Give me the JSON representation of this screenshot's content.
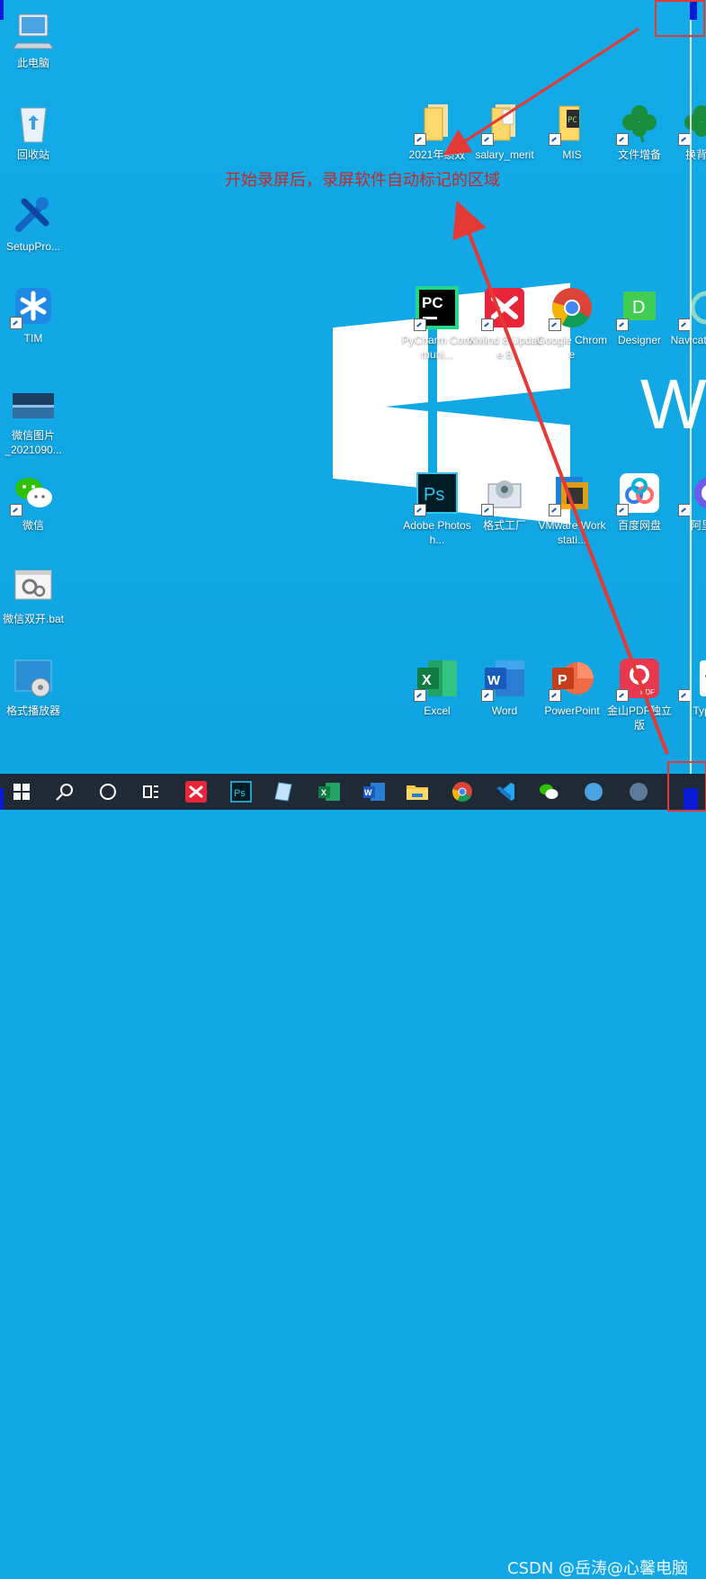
{
  "desktop": {
    "icons_left": [
      {
        "label": "此电脑",
        "icon": "computer-icon"
      },
      {
        "label": "回收站",
        "icon": "recycle-bin-icon"
      },
      {
        "label": "SetupPro...",
        "icon": "tools-icon"
      },
      {
        "label": "TIM",
        "icon": "tim-icon"
      },
      {
        "label": "微信图片\n_2021090...",
        "icon": "image-thumbnail-icon"
      },
      {
        "label": "微信",
        "icon": "wechat-icon"
      },
      {
        "label": "微信双开.bat",
        "icon": "bat-file-icon"
      },
      {
        "label": "格式播放器",
        "icon": "media-player-icon"
      }
    ],
    "icons_top_row": [
      {
        "label": "2021年绩效",
        "icon": "folder-icon"
      },
      {
        "label": "salary_merit",
        "icon": "folder-icon"
      },
      {
        "label": "MIS",
        "icon": "folder-icon"
      },
      {
        "label": "文件增备",
        "icon": "clover-icon"
      },
      {
        "label": "换背景",
        "icon": "clover-icon"
      }
    ],
    "icons_row2": [
      {
        "label": "PyCharm Communi...",
        "icon": "pycharm-icon"
      },
      {
        "label": "XMind 8 Update 8",
        "icon": "xmind-icon"
      },
      {
        "label": "Google Chrome",
        "icon": "chrome-icon"
      },
      {
        "label": "Designer",
        "icon": "designer-icon"
      },
      {
        "label": "Navicat for S",
        "icon": "navicat-icon"
      }
    ],
    "icons_row3": [
      {
        "label": "Adobe Photosh...",
        "icon": "photoshop-icon"
      },
      {
        "label": "格式工厂",
        "icon": "format-factory-icon"
      },
      {
        "label": "VMware Workstati...",
        "icon": "vmware-icon"
      },
      {
        "label": "百度网盘",
        "icon": "baidu-netdisk-icon"
      },
      {
        "label": "阿里",
        "icon": "aliyun-icon"
      }
    ],
    "icons_row4": [
      {
        "label": "Excel",
        "icon": "excel-icon"
      },
      {
        "label": "Word",
        "icon": "word-icon"
      },
      {
        "label": "PowerPoint",
        "icon": "powerpoint-icon"
      },
      {
        "label": "金山PDF独立版",
        "icon": "kingsoft-pdf-icon"
      },
      {
        "label": "Typ",
        "icon": "typora-icon"
      }
    ],
    "windows_text": "Wi"
  },
  "annotation": {
    "caption": "开始录屏后，录屏软件自动标记的区域",
    "arrow_color": "#e53935"
  },
  "taskbar": {
    "items": [
      "start-icon",
      "search-icon",
      "cortana-icon",
      "task-view-icon",
      "xmind-icon",
      "photoshop-icon",
      "notepad-icon",
      "excel-icon",
      "word-icon",
      "file-explorer-icon",
      "chrome-icon",
      "vscode-icon",
      "wechat-icon",
      "app-icon",
      "network-icon"
    ],
    "watermark": "CSDN @岳涛@心馨电脑"
  },
  "colors": {
    "desktop": "#11a7e6",
    "taskbar": "#202a36",
    "marker": "#0a1bd8"
  }
}
